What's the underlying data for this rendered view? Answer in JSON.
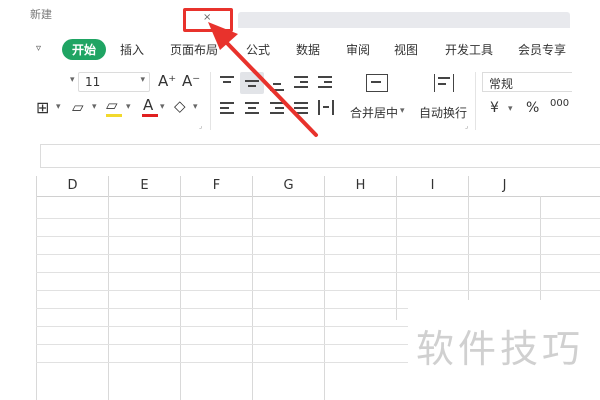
{
  "titlebar": {
    "doc_fragment": "新建",
    "tab_mark": "×"
  },
  "ribbon": {
    "menu_dropdown": "▿",
    "tabs": [
      {
        "label": "开始",
        "active": true
      },
      {
        "label": "插入"
      },
      {
        "label": "页面布局"
      },
      {
        "label": "公式"
      },
      {
        "label": "数据"
      },
      {
        "label": "审阅"
      },
      {
        "label": "视图"
      },
      {
        "label": "开发工具"
      },
      {
        "label": "会员专享"
      }
    ]
  },
  "toolbar": {
    "font_size": "11",
    "font_size_arrow": "▾",
    "font_name_arrow": "▾",
    "grow_font": "A⁺",
    "shrink_font": "A⁻",
    "border_icon": "⊞",
    "border_arrow": "▾",
    "fill_icon": "▱",
    "fill_color": "#f2d92d",
    "font_color_icon": "A",
    "font_color": "#e02020",
    "eraser_icon": "◇",
    "merge_label": "合并居中",
    "merge_arrow": "▾",
    "wrap_label": "自动换行",
    "number_format": "常规",
    "currency": "¥",
    "percent": "%",
    "thousands": "000",
    "corner_mark": "⌟"
  },
  "sheet": {
    "columns": [
      "D",
      "E",
      "F",
      "G",
      "H",
      "I",
      "J"
    ]
  },
  "watermark": {
    "text": "软件技巧"
  },
  "annotation": {
    "color": "#e8322c"
  }
}
